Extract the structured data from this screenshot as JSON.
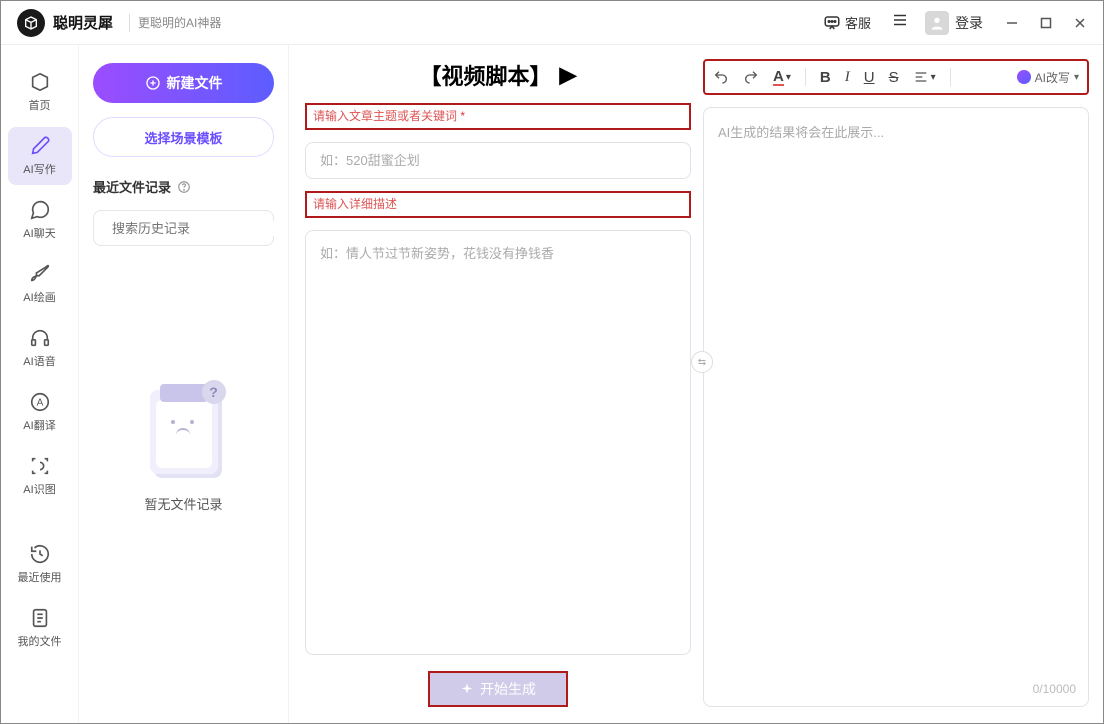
{
  "app": {
    "name": "聪明灵犀",
    "tagline": "更聪明的AI神器"
  },
  "titlebar": {
    "service": "客服",
    "login": "登录"
  },
  "rail": {
    "items": [
      {
        "label": "首页",
        "icon": "home"
      },
      {
        "label": "AI写作",
        "icon": "pen",
        "active": true
      },
      {
        "label": "AI聊天",
        "icon": "chat"
      },
      {
        "label": "AI绘画",
        "icon": "brush"
      },
      {
        "label": "AI语音",
        "icon": "voice"
      },
      {
        "label": "AI翻译",
        "icon": "translate"
      },
      {
        "label": "AI识图",
        "icon": "scan"
      }
    ],
    "below": [
      {
        "label": "最近使用",
        "icon": "history"
      },
      {
        "label": "我的文件",
        "icon": "files"
      }
    ]
  },
  "files": {
    "new_file": "新建文件",
    "choose_template": "选择场景模板",
    "recent_label": "最近文件记录",
    "search_placeholder": "搜索历史记录",
    "empty": "暂无文件记录"
  },
  "editor": {
    "title_full": "【视频脚本】",
    "label_topic": "请输入文章主题或者关键词",
    "label_topic_required": "*",
    "topic_placeholder": "如：520甜蜜企划",
    "label_desc": "请输入详细描述",
    "desc_placeholder": "如：情人节过节新姿势，花钱没有挣钱香",
    "generate": "开始生成",
    "result_placeholder": "AI生成的结果将会在此展示...",
    "counter": "0/10000",
    "ai_rewrite": "AI改写"
  }
}
